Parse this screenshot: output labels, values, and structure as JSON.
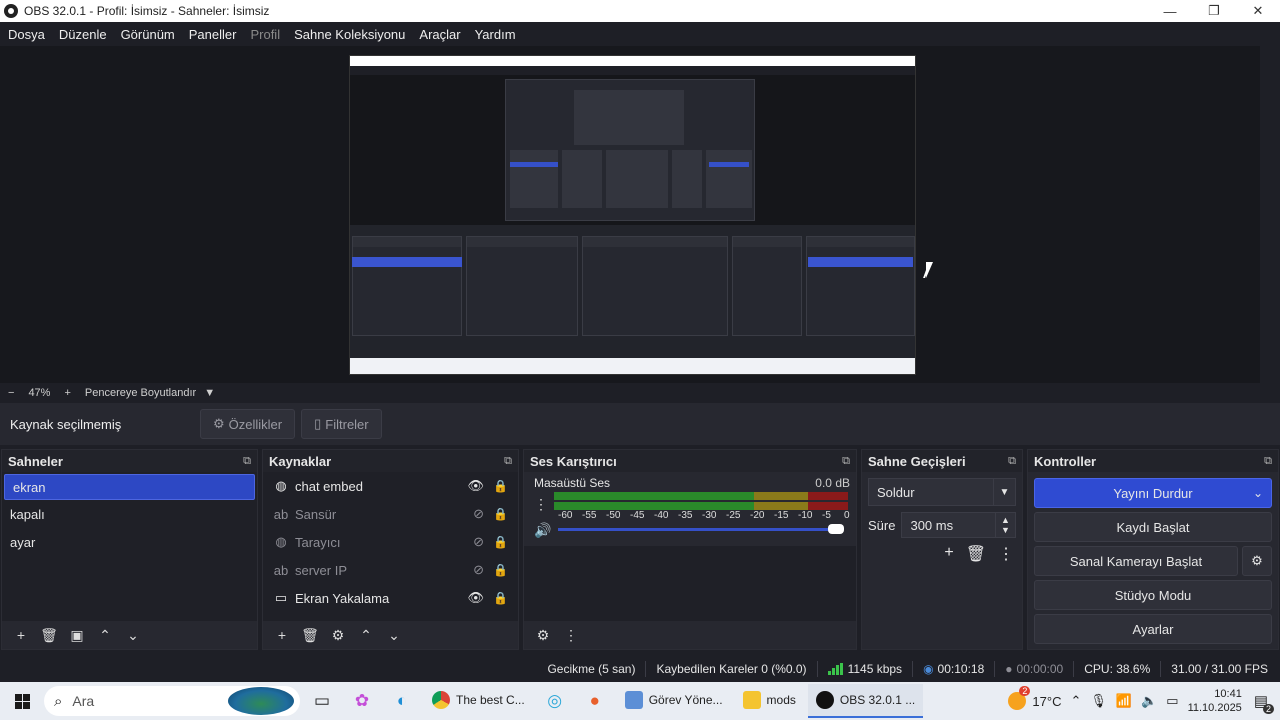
{
  "window": {
    "title": "OBS 32.0.1 - Profil: İsimsiz - Sahneler: İsimsiz",
    "minimize": "—",
    "maximize": "❐",
    "close": "✕"
  },
  "menu": {
    "items": [
      "Dosya",
      "Düzenle",
      "Görünüm",
      "Paneller",
      "Profil",
      "Sahne Koleksiyonu",
      "Araçlar",
      "Yardım"
    ]
  },
  "zoom": {
    "minus": "−",
    "value": "47%",
    "plus": "+",
    "mode": "Pencereye Boyutlandır",
    "arrow": "▼"
  },
  "source_toolbar": {
    "status": "Kaynak seçilmemiş",
    "properties": "Özellikler",
    "filters": "Filtreler"
  },
  "scenes": {
    "title": "Sahneler",
    "items": [
      "ekran",
      "kapalı",
      "ayar"
    ],
    "selected_index": 0
  },
  "sources": {
    "title": "Kaynaklar",
    "items": [
      {
        "name": "chat embed",
        "icon": "globe-icon",
        "visible": true
      },
      {
        "name": "Sansür",
        "icon": "filter-icon",
        "visible": false
      },
      {
        "name": "Tarayıcı",
        "icon": "globe-icon",
        "visible": false
      },
      {
        "name": "server IP",
        "icon": "filter-icon",
        "visible": false
      },
      {
        "name": "Ekran Yakalama",
        "icon": "monitor-icon",
        "visible": true
      }
    ]
  },
  "mixer": {
    "title": "Ses Karıştırıcı",
    "track_name": "Masaüstü Ses",
    "level": "0.0 dB",
    "scale": [
      "-60",
      "-55",
      "-50",
      "-45",
      "-40",
      "-35",
      "-30",
      "-25",
      "-20",
      "-15",
      "-10",
      "-5",
      "0"
    ],
    "volume_fraction": 1.0
  },
  "transitions": {
    "title": "Sahne Geçişleri",
    "selected": "Soldur",
    "duration_label": "Süre",
    "duration_value": "300 ms"
  },
  "controls": {
    "title": "Kontroller",
    "stop_stream": "Yayını Durdur",
    "start_record": "Kaydı Başlat",
    "start_virtualcam": "Sanal Kamerayı Başlat",
    "studio_mode": "Stüdyo Modu",
    "settings": "Ayarlar"
  },
  "status": {
    "delay": "Gecikme (5 san)",
    "dropped": "Kaybedilen Kareler 0 (%0.0)",
    "bitrate": "1145 kbps",
    "stream_time": "00:10:18",
    "record_time": "00:00:00",
    "cpu": "CPU: 38.6%",
    "fps": "31.00 / 31.00 FPS"
  },
  "taskbar": {
    "search_placeholder": "Ara",
    "apps": [
      {
        "label": "The best C...",
        "color": "#db4437"
      },
      {
        "label": "Görev Yöne...",
        "color": "#5c8fd6"
      },
      {
        "label": "mods",
        "color": "#f4c430"
      },
      {
        "label": "OBS 32.0.1 ...",
        "color": "#111111"
      }
    ],
    "weather_badge": "2",
    "weather": "17°C",
    "time": "10:41",
    "date": "11.10.2025",
    "notifications": "2"
  },
  "colors": {
    "accent": "#2f4bd2",
    "meter_green": "#2a8a2a",
    "meter_yellow": "#8a7a1a",
    "meter_red": "#8a1a1a"
  }
}
